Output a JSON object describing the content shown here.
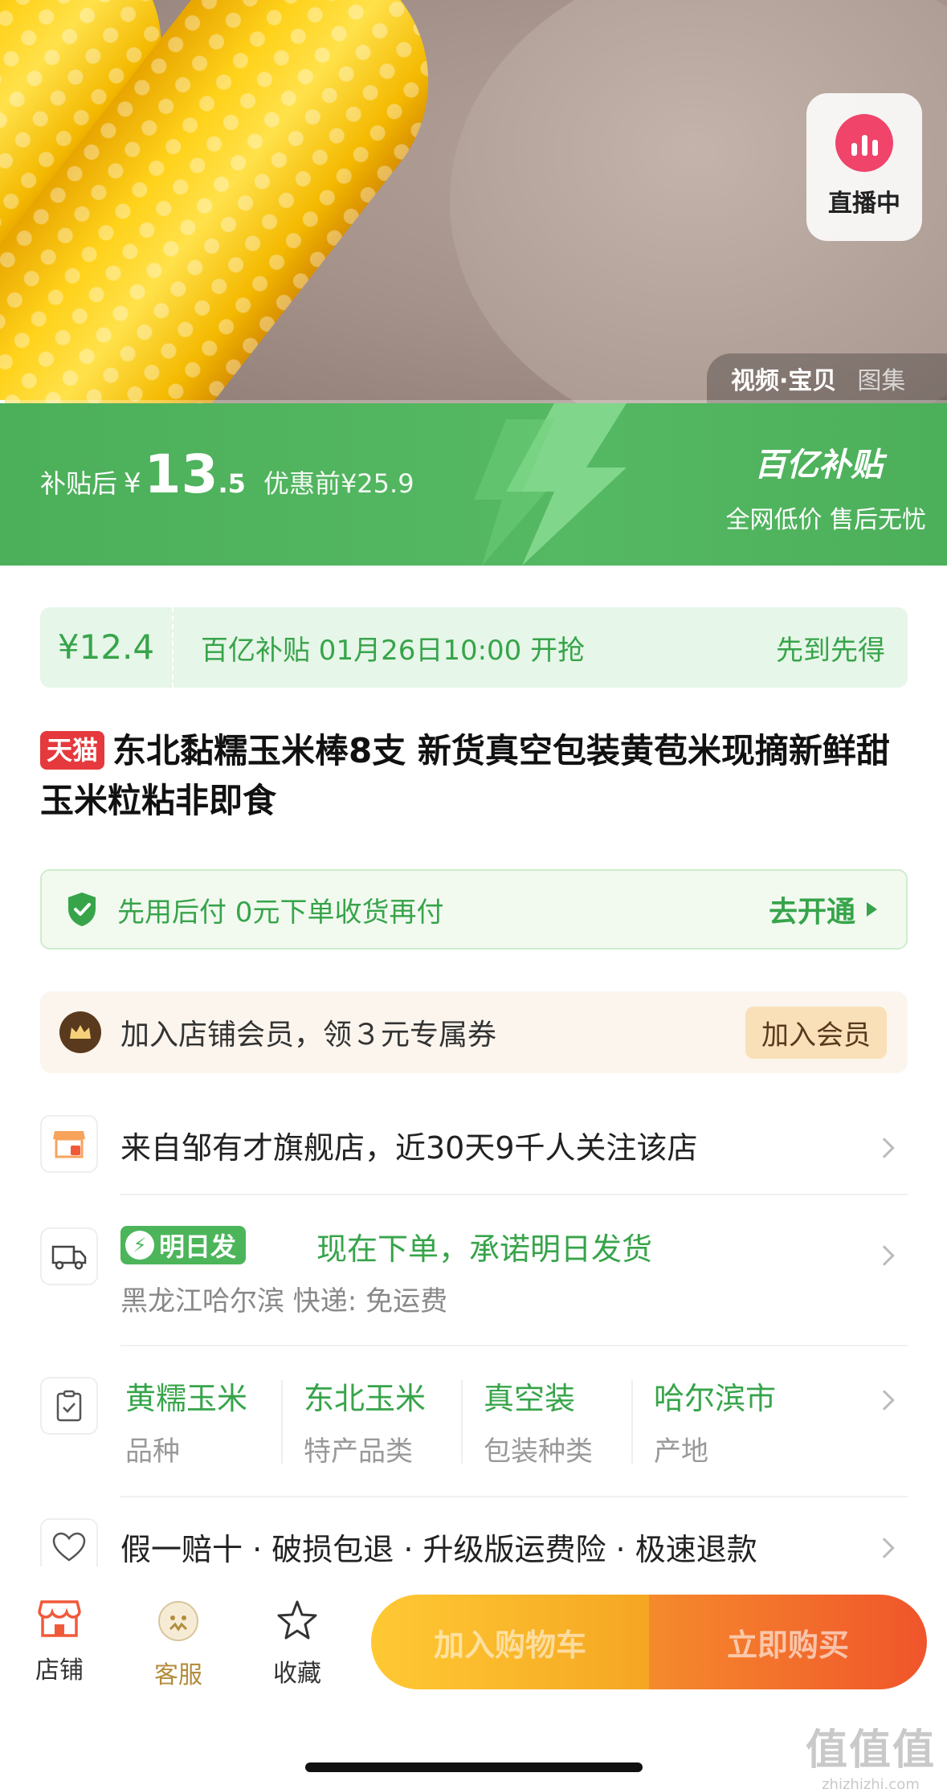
{
  "hero": {
    "live_label": "直播中",
    "media_tabs": [
      "视频·宝贝",
      "图集"
    ]
  },
  "subsidy": {
    "label": "补贴后",
    "currency": "¥",
    "price_int": "13",
    "price_dec": ".5",
    "original": "优惠前¥25.9",
    "brand": "百亿补贴",
    "slogan": "全网低价 售后无忧",
    "colors": {
      "bg": "#4caf5a"
    }
  },
  "coupon": {
    "price": "¥12.4",
    "text": "百亿补贴 01月26日10:00 开抢",
    "right": "先到先得"
  },
  "title": {
    "badge": "天猫",
    "text": "东北黏糯玉米棒8支 新货真空包装黄苞米现摘新鲜甜玉米粒粘非即食"
  },
  "paylater": {
    "text": "先用后付  0元下单收货再付",
    "action": "去开通"
  },
  "member": {
    "text": "加入店铺会员，领３元专属券",
    "action": "加入会员"
  },
  "store": {
    "text": "来自邹有才旗舰店，近30天9千人关注该店"
  },
  "shipping": {
    "badge": "明日发",
    "promise": "现在下单，承诺明日发货",
    "sub": "黑龙江哈尔滨  快递: 免运费"
  },
  "attributes": [
    {
      "value": "黄糯玉米",
      "key": "品种"
    },
    {
      "value": "东北玉米",
      "key": "特产品类"
    },
    {
      "value": "真空装",
      "key": "包装种类"
    },
    {
      "value": "哈尔滨市",
      "key": "产地"
    }
  ],
  "guarantee": {
    "text": "假一赔十 · 破损包退 · 升级版运费险 · 极速退款"
  },
  "bottombar": {
    "store": "店铺",
    "service": "客服",
    "favorite": "收藏",
    "add_cart": "加入购物车",
    "buy_now": "立即购买"
  },
  "watermark": {
    "main": "值值值",
    "sub": "zhizhizhi.com"
  }
}
